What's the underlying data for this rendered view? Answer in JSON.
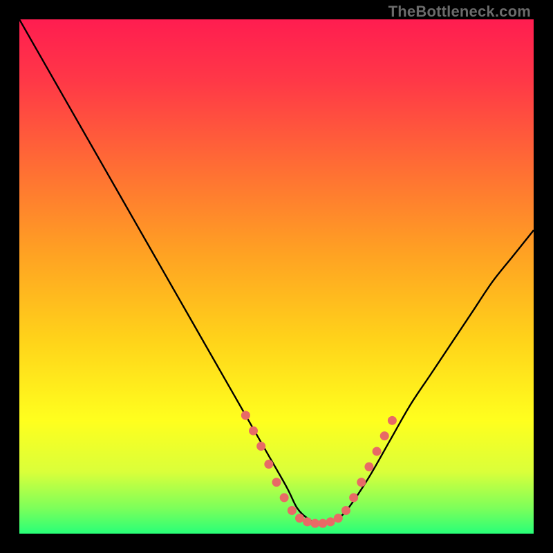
{
  "watermark": "TheBottleneck.com",
  "chart_data": {
    "type": "line",
    "title": "",
    "xlabel": "",
    "ylabel": "",
    "xlim": [
      0,
      100
    ],
    "ylim": [
      0,
      100
    ],
    "grid": false,
    "legend": false,
    "background_gradient": {
      "stops": [
        {
          "offset": 0.0,
          "color": "#ff1d50"
        },
        {
          "offset": 0.12,
          "color": "#ff3847"
        },
        {
          "offset": 0.28,
          "color": "#ff6b35"
        },
        {
          "offset": 0.45,
          "color": "#ffa023"
        },
        {
          "offset": 0.62,
          "color": "#ffd21a"
        },
        {
          "offset": 0.78,
          "color": "#ffff1e"
        },
        {
          "offset": 0.88,
          "color": "#daff3a"
        },
        {
          "offset": 0.95,
          "color": "#7dff5a"
        },
        {
          "offset": 1.0,
          "color": "#28ff78"
        }
      ]
    },
    "series": [
      {
        "name": "bottleneck-curve",
        "color": "#000000",
        "x": [
          0,
          4,
          8,
          12,
          16,
          20,
          24,
          28,
          32,
          36,
          40,
          44,
          48,
          52,
          54,
          56,
          58,
          60,
          62,
          64,
          68,
          72,
          76,
          80,
          84,
          88,
          92,
          96,
          100
        ],
        "y": [
          100,
          93,
          86,
          79,
          72,
          65,
          58,
          51,
          44,
          37,
          30,
          23,
          16,
          9,
          5,
          3,
          2,
          2,
          3,
          5,
          11,
          18,
          25,
          31,
          37,
          43,
          49,
          54,
          59
        ]
      }
    ],
    "highlight_segments": [
      {
        "name": "left-dotted",
        "color": "#e86a66",
        "points": [
          {
            "x": 44.0,
            "y": 23.0
          },
          {
            "x": 45.5,
            "y": 20.0
          },
          {
            "x": 47.0,
            "y": 17.0
          },
          {
            "x": 48.5,
            "y": 13.5
          },
          {
            "x": 50.0,
            "y": 10.0
          },
          {
            "x": 51.5,
            "y": 7.0
          },
          {
            "x": 53.0,
            "y": 4.5
          }
        ]
      },
      {
        "name": "bottom-dotted",
        "color": "#e86a66",
        "points": [
          {
            "x": 54.5,
            "y": 3.0
          },
          {
            "x": 56.0,
            "y": 2.3
          },
          {
            "x": 57.5,
            "y": 2.0
          },
          {
            "x": 59.0,
            "y": 2.0
          },
          {
            "x": 60.5,
            "y": 2.3
          },
          {
            "x": 62.0,
            "y": 3.0
          }
        ]
      },
      {
        "name": "right-dotted",
        "color": "#e86a66",
        "points": [
          {
            "x": 63.5,
            "y": 4.5
          },
          {
            "x": 65.0,
            "y": 7.0
          },
          {
            "x": 66.5,
            "y": 10.0
          },
          {
            "x": 68.0,
            "y": 13.0
          },
          {
            "x": 69.5,
            "y": 16.0
          },
          {
            "x": 71.0,
            "y": 19.0
          },
          {
            "x": 72.5,
            "y": 22.0
          }
        ]
      }
    ]
  }
}
